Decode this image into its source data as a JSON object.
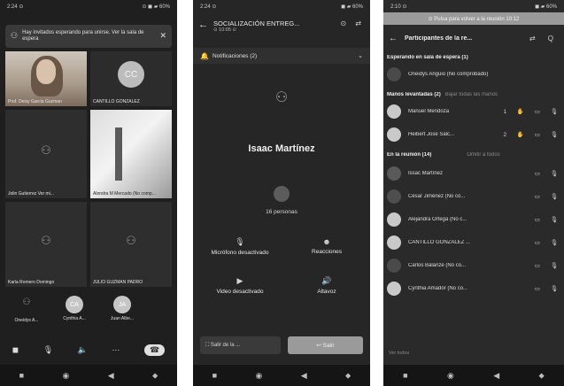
{
  "phone1": {
    "status": {
      "time": "2:24 ⊙",
      "icons": "⊙ ◼ ▰ 60%"
    },
    "banner": {
      "text": "Hay invitados esperando para unirse. Ver la sala de espera",
      "close": "✕"
    },
    "tiles": [
      {
        "name": "Prof. Deisy Garcia Guzman"
      },
      {
        "name": "CANTILLO GONZALEZ",
        "initials": "CC"
      },
      {
        "name": "Jolin Gutierrez   Ver mi..."
      },
      {
        "name": "Alondra M Mercado (No comp..."
      },
      {
        "name": "Karla Romero Domingo"
      },
      {
        "name": "JULIO GUZMAN PADRO"
      }
    ],
    "strip": [
      {
        "name": "Oneidys A...",
        "initials": ""
      },
      {
        "name": "Cynthia A...",
        "initials": "CA"
      },
      {
        "name": "Juan Albe...",
        "initials": "JA"
      }
    ],
    "controls": [
      "◼",
      "🎙",
      "🔈",
      "···",
      "☎"
    ],
    "nav": [
      "■",
      "◉",
      "◀",
      "⬥"
    ]
  },
  "phone2": {
    "status": {
      "time": "2:24 ⊙",
      "icons": "◼ ▰ 60%"
    },
    "header": {
      "title": "SOCIALIZACIÓN ENTREG...",
      "subtitle": "⊙ 10:05 ⊙",
      "back": "←",
      "icons": "⊙ ⇄"
    },
    "notifications": {
      "label": "Notificaciones (2)",
      "chevron": "⌄"
    },
    "speaker": "Isaac Martínez",
    "people_count": "16 personas",
    "options": [
      {
        "icon": "🎙",
        "label": "Micrófono desactivado"
      },
      {
        "icon": "☻",
        "label": "Reacciones"
      },
      {
        "icon": "▶",
        "label": "Video desactivado"
      },
      {
        "icon": "🔊",
        "label": "Altavoz"
      }
    ],
    "bottom": {
      "breakout": "⛶ Salir de la ...",
      "leave": "↩ Salir"
    },
    "nav": [
      "■",
      "◉",
      "◀",
      "⬥"
    ]
  },
  "phone3": {
    "status": {
      "time": "2:10 ⊙",
      "icons": "◼ ▰ 60%"
    },
    "return_bar": "⊙ Pulsa para volver a la reunión 10:12",
    "header": {
      "title": "Participantes de la re...",
      "back": "←",
      "icons": "⇄ Q"
    },
    "sections": {
      "waiting": "Esperando en sala de espera (1)",
      "raised": "Manos levantadas (2)",
      "raised_side": "Bajar todas las manos",
      "in_meeting": "En la reunión (14)",
      "in_meeting_side": "Omitir a todos"
    },
    "waiting": [
      {
        "name": "Oneidys Anguio (No comprobado)"
      }
    ],
    "raised": [
      {
        "name": "Manuel Mendoza",
        "icons": "1 ✋ ▭ 🎙"
      },
      {
        "name": "Heibert José Salc...",
        "icons": "2 ✋ ▭ 🎙"
      }
    ],
    "members": [
      {
        "name": "Issac Martínez",
        "icons": "▭ 🎙"
      },
      {
        "name": "César Jiménez (No co...",
        "icons": "▭ 🎙"
      },
      {
        "name": "Alejandra Ortega (No c...",
        "icons": "▭ 🎙"
      },
      {
        "name": "CANTILLO GONZALEZ ...",
        "icons": "▭ 🎙"
      },
      {
        "name": "Carlos Balanze (No co...",
        "icons": "▭ 🎙"
      },
      {
        "name": "Cynthia Amador (No co...",
        "icons": "▭ 🎙"
      }
    ],
    "footer": "Ver todos",
    "nav": [
      "■",
      "◉",
      "◀",
      "⬥"
    ]
  }
}
